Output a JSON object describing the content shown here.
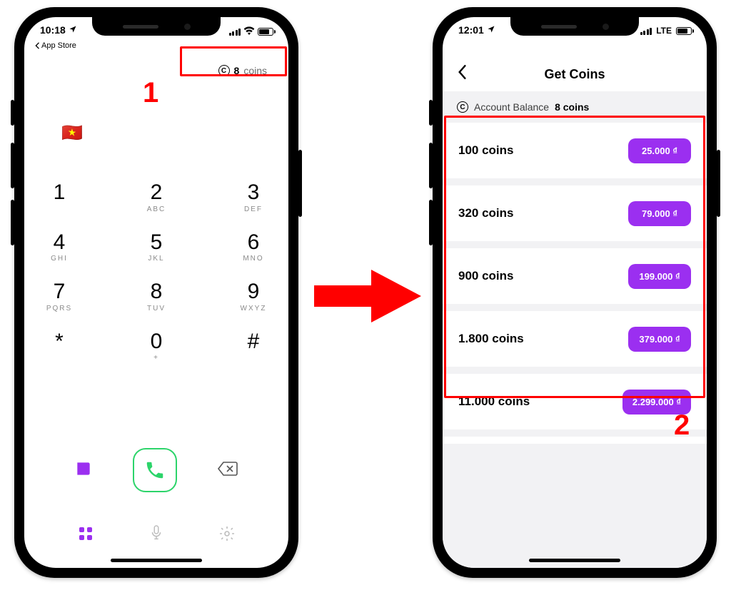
{
  "annotations": {
    "label1": "1",
    "label2": "2"
  },
  "phoneLeft": {
    "status": {
      "time": "10:18",
      "back": "App Store"
    },
    "coins": {
      "count": "8",
      "unit": "coins"
    },
    "flag": "🇻🇳",
    "keypad": [
      [
        {
          "d": "1",
          "l": ""
        },
        {
          "d": "2",
          "l": "ABC"
        },
        {
          "d": "3",
          "l": "DEF"
        }
      ],
      [
        {
          "d": "4",
          "l": "GHI"
        },
        {
          "d": "5",
          "l": "JKL"
        },
        {
          "d": "6",
          "l": "MNO"
        }
      ],
      [
        {
          "d": "7",
          "l": "PQRS"
        },
        {
          "d": "8",
          "l": "TUV"
        },
        {
          "d": "9",
          "l": "WXYZ"
        }
      ],
      [
        {
          "d": "*",
          "l": ""
        },
        {
          "d": "0",
          "l": "+"
        },
        {
          "d": "#",
          "l": ""
        }
      ]
    ]
  },
  "phoneRight": {
    "status": {
      "time": "12:01",
      "network": "LTE"
    },
    "header": {
      "title": "Get Coins"
    },
    "balance": {
      "label": "Account Balance",
      "value": "8 coins"
    },
    "packs": [
      {
        "amount": "100 coins",
        "price": "25.000 ₫"
      },
      {
        "amount": "320 coins",
        "price": "79.000 ₫"
      },
      {
        "amount": "900 coins",
        "price": "199.000 ₫"
      },
      {
        "amount": "1.800 coins",
        "price": "379.000 ₫"
      },
      {
        "amount": "11.000 coins",
        "price": "2.299.000 ₫"
      }
    ]
  }
}
